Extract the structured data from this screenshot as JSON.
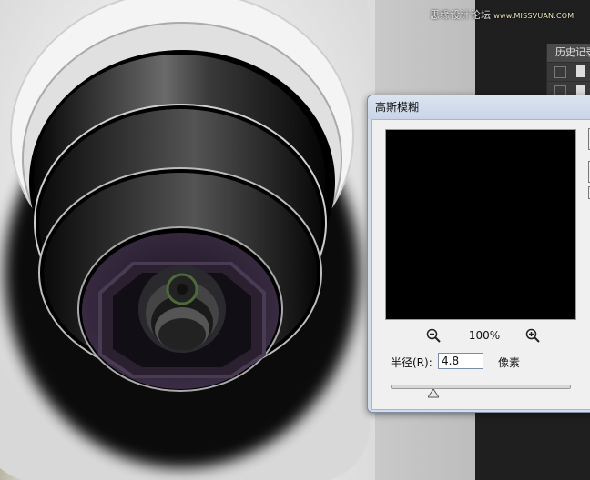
{
  "watermark": {
    "text": "思缘设计论坛",
    "site": "www.MISSVUAN.COM"
  },
  "history_panel": {
    "title": "历史记录"
  },
  "dialog": {
    "title": "高斯模糊",
    "zoom": "100%",
    "radius_label": "半径(R):",
    "radius_value": "4.8",
    "unit": "像素",
    "radius_slider_fraction": 0.24
  },
  "colors": {
    "dialog_title_bg": "#c9d5e6",
    "preview_bg": "#000000",
    "lens_purple": "#2e2235"
  },
  "icons": [
    "zoom-out-icon",
    "zoom-in-icon",
    "slider-thumb-icon",
    "history-doc-icon"
  ]
}
